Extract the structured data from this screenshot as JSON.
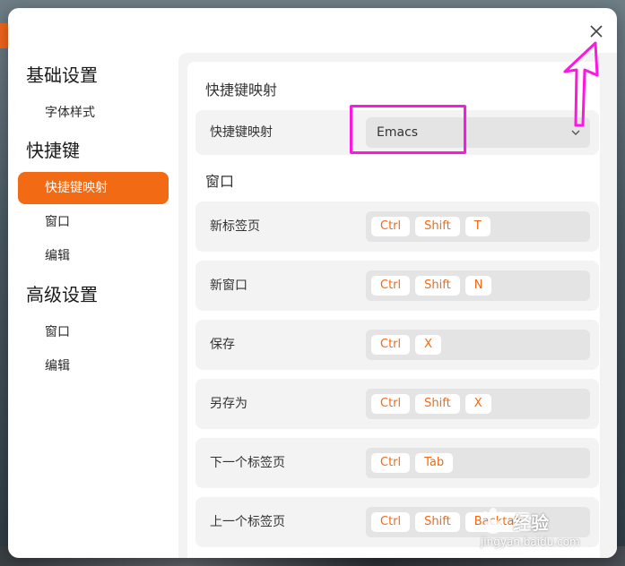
{
  "sidebar": {
    "groups": [
      {
        "title": "基础设置",
        "items": [
          "字体样式"
        ]
      },
      {
        "title": "快捷键",
        "items": [
          "快捷键映射",
          "窗口",
          "编辑"
        ]
      },
      {
        "title": "高级设置",
        "items": [
          "窗口",
          "编辑"
        ]
      }
    ],
    "active_item": "快捷键映射"
  },
  "keymap_section": {
    "title": "快捷键映射",
    "row_label": "快捷键映射",
    "selected": "Emacs"
  },
  "window_section": {
    "title": "窗口",
    "rows": [
      {
        "label": "新标签页",
        "keys": [
          "Ctrl",
          "Shift",
          "T"
        ]
      },
      {
        "label": "新窗口",
        "keys": [
          "Ctrl",
          "Shift",
          "N"
        ]
      },
      {
        "label": "保存",
        "keys": [
          "Ctrl",
          "X"
        ]
      },
      {
        "label": "另存为",
        "keys": [
          "Ctrl",
          "Shift",
          "X"
        ]
      },
      {
        "label": "下一个标签页",
        "keys": [
          "Ctrl",
          "Tab"
        ]
      },
      {
        "label": "上一个标签页",
        "keys": [
          "Ctrl",
          "Shift",
          "Backtab"
        ]
      }
    ]
  },
  "watermark": {
    "text": "经验",
    "url": "jingyan.baidu.com"
  },
  "colors": {
    "accent": "#f26a14",
    "highlight": "#ff16e0"
  },
  "icons": {
    "close": "close-icon",
    "dropdown": "chevron-down-icon"
  }
}
